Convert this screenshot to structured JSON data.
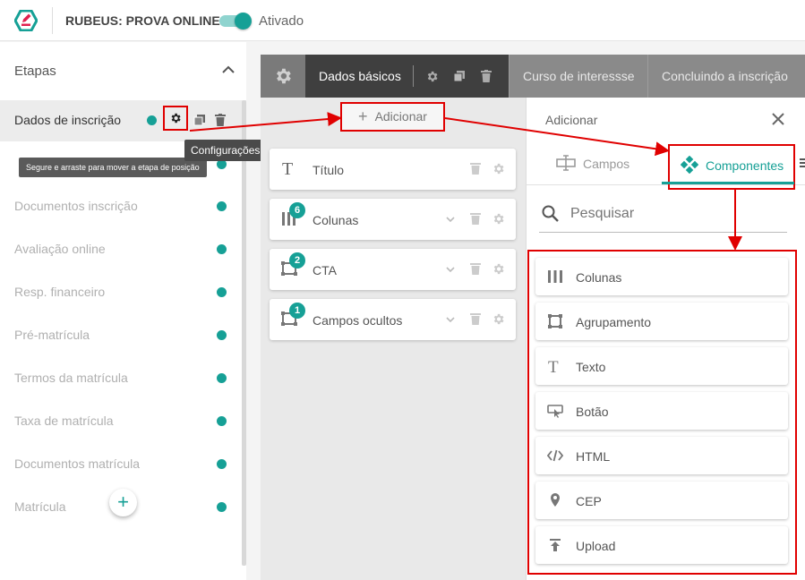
{
  "header": {
    "app_title": "RUBEUS: PROVA ONLINE",
    "toggle_label": "Ativado"
  },
  "sidebar": {
    "title": "Etapas",
    "active_step": "Dados de inscrição",
    "steps": [
      "Documentos inscrição",
      "Avaliação online",
      "Resp. financeiro",
      "Pré-matrícula",
      "Termos da matrícula",
      "Taxa de matrícula",
      "Documentos matrícula",
      "Matrícula"
    ],
    "add_button": "+"
  },
  "tooltips": {
    "config": "Configurações",
    "drag": "Segure e arraste para mover a etapa de posição"
  },
  "tabs": {
    "active": "Dados básicos",
    "others": [
      "Curso de interessse",
      "Concluindo a inscrição"
    ]
  },
  "add_button": {
    "label": "Adicionar"
  },
  "blocks": [
    {
      "label": "Título",
      "icon": "text-icon",
      "badge": ""
    },
    {
      "label": "Colunas",
      "icon": "columns-icon",
      "badge": "6"
    },
    {
      "label": "CTA",
      "icon": "group-icon",
      "badge": "2"
    },
    {
      "label": "Campos ocultos",
      "icon": "group-icon",
      "badge": "1"
    }
  ],
  "panel": {
    "title": "Adicionar",
    "tab_fields": "Campos",
    "tab_components": "Componentes",
    "search_placeholder": "Pesquisar",
    "components": [
      {
        "label": "Colunas",
        "icon": "columns-icon"
      },
      {
        "label": "Agrupamento",
        "icon": "group-icon"
      },
      {
        "label": "Texto",
        "icon": "text-icon"
      },
      {
        "label": "Botão",
        "icon": "button-icon"
      },
      {
        "label": "HTML",
        "icon": "code-icon"
      },
      {
        "label": "CEP",
        "icon": "location-pin-icon"
      },
      {
        "label": "Upload",
        "icon": "upload-icon"
      }
    ]
  },
  "colors": {
    "accent": "#16a096",
    "highlight": "#e00000"
  }
}
